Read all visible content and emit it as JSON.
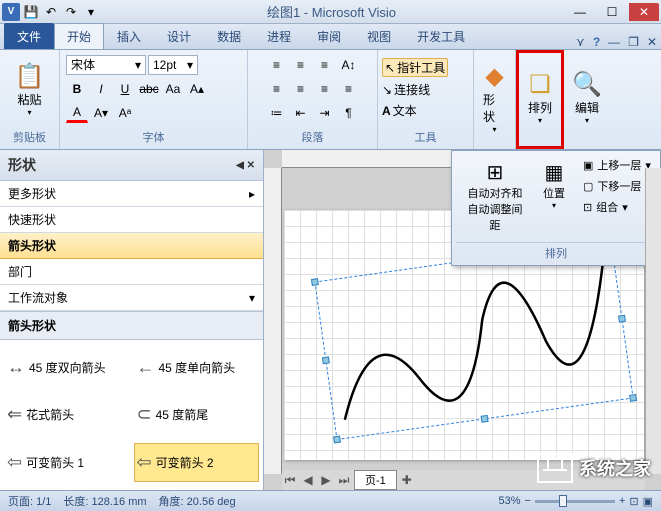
{
  "titlebar": {
    "appIconAlt": "V",
    "title": "绘图1 - Microsoft Visio"
  },
  "tabs": {
    "file": "文件",
    "home": "开始",
    "insert": "插入",
    "design": "设计",
    "data": "数据",
    "process": "进程",
    "review": "审阅",
    "view": "视图",
    "developer": "开发工具"
  },
  "ribbon": {
    "clipboard": {
      "paste": "粘贴",
      "label": "剪贴板"
    },
    "font": {
      "family": "宋体",
      "size": "12pt",
      "bold": "B",
      "italic": "I",
      "underline": "U",
      "strike": "abc",
      "caseBtn": "Aa",
      "label": "字体"
    },
    "paragraph": {
      "label": "段落"
    },
    "tools": {
      "pointer": "指针工具",
      "connector": "连接线",
      "text": "文本",
      "label": "工具"
    },
    "shape": {
      "label": "形状"
    },
    "arrange": {
      "label": "排列"
    },
    "edit": {
      "label": "编辑"
    }
  },
  "shapes": {
    "title": "形状",
    "items": [
      "更多形状",
      "快速形状",
      "箭头形状",
      "部门",
      "工作流对象"
    ],
    "selectedIndex": 2,
    "stencilTitle": "箭头形状",
    "masters": [
      {
        "name": "45 度双向箭头"
      },
      {
        "name": "45 度单向箭头"
      },
      {
        "name": "花式箭头"
      },
      {
        "name": "45 度箭尾"
      },
      {
        "name": "可变箭头 1"
      },
      {
        "name": "可变箭头 2"
      }
    ],
    "mastersSelectedIndex": 5
  },
  "popup": {
    "autoAlign": "自动对齐和自动调整间距",
    "position": "位置",
    "bringForward": "上移一层",
    "sendBackward": "下移一层",
    "group": "组合",
    "footer": "排列"
  },
  "canvas": {
    "pageTab": "页-1"
  },
  "statusbar": {
    "page": "页面: 1/1",
    "length": "长度: 128.16 mm",
    "angle": "角度: 20.56 deg",
    "zoom": "53%"
  },
  "watermark": "系统之家"
}
